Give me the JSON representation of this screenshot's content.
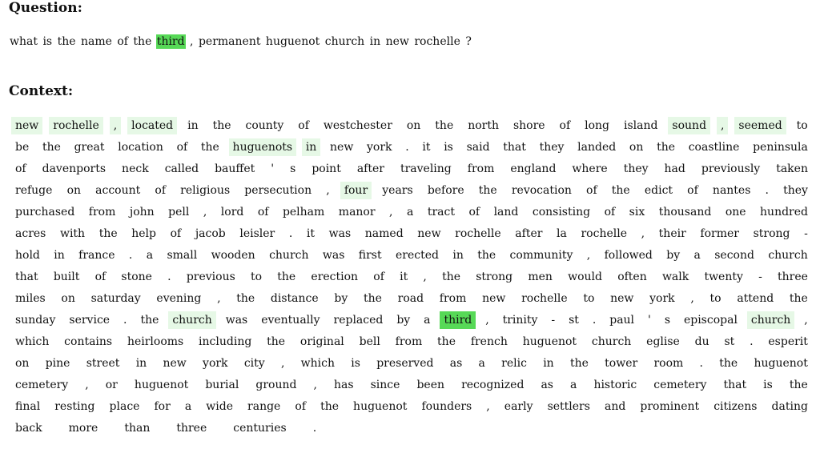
{
  "question_heading": "Question:",
  "context_heading": "Context:",
  "highlight_colors": {
    "strong": "#57d957",
    "light": "#e6f8e6"
  },
  "question_tokens": [
    {
      "t": "what",
      "h": ""
    },
    {
      "t": "is",
      "h": ""
    },
    {
      "t": "the",
      "h": ""
    },
    {
      "t": "name",
      "h": ""
    },
    {
      "t": "of",
      "h": ""
    },
    {
      "t": "the",
      "h": ""
    },
    {
      "t": "third",
      "h": "strong"
    },
    {
      "t": ",",
      "h": ""
    },
    {
      "t": "permanent",
      "h": ""
    },
    {
      "t": "huguenot",
      "h": ""
    },
    {
      "t": "church",
      "h": ""
    },
    {
      "t": "in",
      "h": ""
    },
    {
      "t": "new",
      "h": ""
    },
    {
      "t": "rochelle",
      "h": ""
    },
    {
      "t": "?",
      "h": ""
    }
  ],
  "context_lines": [
    [
      {
        "t": "new",
        "h": "light"
      },
      {
        "t": "rochelle",
        "h": "light"
      },
      {
        "t": ",",
        "h": "light"
      },
      {
        "t": "located",
        "h": "light"
      },
      {
        "t": "in",
        "h": ""
      },
      {
        "t": "the",
        "h": ""
      },
      {
        "t": "county",
        "h": ""
      },
      {
        "t": "of",
        "h": ""
      },
      {
        "t": "westchester",
        "h": ""
      },
      {
        "t": "on",
        "h": ""
      },
      {
        "t": "the",
        "h": ""
      },
      {
        "t": "north",
        "h": ""
      },
      {
        "t": "shore",
        "h": ""
      },
      {
        "t": "of",
        "h": ""
      },
      {
        "t": "long",
        "h": ""
      },
      {
        "t": "island",
        "h": ""
      },
      {
        "t": "sound",
        "h": "light"
      },
      {
        "t": ",",
        "h": "light"
      },
      {
        "t": "seemed",
        "h": "light"
      },
      {
        "t": "to",
        "h": ""
      }
    ],
    [
      {
        "t": "be",
        "h": ""
      },
      {
        "t": "the",
        "h": ""
      },
      {
        "t": "great",
        "h": ""
      },
      {
        "t": "location",
        "h": ""
      },
      {
        "t": "of",
        "h": ""
      },
      {
        "t": "the",
        "h": ""
      },
      {
        "t": "huguenots",
        "h": "light"
      },
      {
        "t": "in",
        "h": "light"
      },
      {
        "t": "new",
        "h": ""
      },
      {
        "t": "york",
        "h": ""
      },
      {
        "t": ".",
        "h": ""
      },
      {
        "t": "it",
        "h": ""
      },
      {
        "t": "is",
        "h": ""
      },
      {
        "t": "said",
        "h": ""
      },
      {
        "t": "that",
        "h": ""
      },
      {
        "t": "they",
        "h": ""
      },
      {
        "t": "landed",
        "h": ""
      },
      {
        "t": "on",
        "h": ""
      },
      {
        "t": "the",
        "h": ""
      },
      {
        "t": "coastline",
        "h": ""
      },
      {
        "t": "peninsula",
        "h": ""
      }
    ],
    [
      {
        "t": "of",
        "h": ""
      },
      {
        "t": "davenports",
        "h": ""
      },
      {
        "t": "neck",
        "h": ""
      },
      {
        "t": "called",
        "h": ""
      },
      {
        "t": "bauffet",
        "h": ""
      },
      {
        "t": "'",
        "h": ""
      },
      {
        "t": "s",
        "h": ""
      },
      {
        "t": "point",
        "h": ""
      },
      {
        "t": "after",
        "h": ""
      },
      {
        "t": "traveling",
        "h": ""
      },
      {
        "t": "from",
        "h": ""
      },
      {
        "t": "england",
        "h": ""
      },
      {
        "t": "where",
        "h": ""
      },
      {
        "t": "they",
        "h": ""
      },
      {
        "t": "had",
        "h": ""
      },
      {
        "t": "previously",
        "h": ""
      },
      {
        "t": "taken",
        "h": ""
      }
    ],
    [
      {
        "t": "refuge",
        "h": ""
      },
      {
        "t": "on",
        "h": ""
      },
      {
        "t": "account",
        "h": ""
      },
      {
        "t": "of",
        "h": ""
      },
      {
        "t": "religious",
        "h": ""
      },
      {
        "t": "persecution",
        "h": ""
      },
      {
        "t": ",",
        "h": ""
      },
      {
        "t": "four",
        "h": "light"
      },
      {
        "t": "years",
        "h": ""
      },
      {
        "t": "before",
        "h": ""
      },
      {
        "t": "the",
        "h": ""
      },
      {
        "t": "revocation",
        "h": ""
      },
      {
        "t": "of",
        "h": ""
      },
      {
        "t": "the",
        "h": ""
      },
      {
        "t": "edict",
        "h": ""
      },
      {
        "t": "of",
        "h": ""
      },
      {
        "t": "nantes",
        "h": ""
      },
      {
        "t": ".",
        "h": ""
      },
      {
        "t": "they",
        "h": ""
      }
    ],
    [
      {
        "t": "purchased",
        "h": ""
      },
      {
        "t": "from",
        "h": ""
      },
      {
        "t": "john",
        "h": ""
      },
      {
        "t": "pell",
        "h": ""
      },
      {
        "t": ",",
        "h": ""
      },
      {
        "t": "lord",
        "h": ""
      },
      {
        "t": "of",
        "h": ""
      },
      {
        "t": "pelham",
        "h": ""
      },
      {
        "t": "manor",
        "h": ""
      },
      {
        "t": ",",
        "h": ""
      },
      {
        "t": "a",
        "h": ""
      },
      {
        "t": "tract",
        "h": ""
      },
      {
        "t": "of",
        "h": ""
      },
      {
        "t": "land",
        "h": ""
      },
      {
        "t": "consisting",
        "h": ""
      },
      {
        "t": "of",
        "h": ""
      },
      {
        "t": "six",
        "h": ""
      },
      {
        "t": "thousand",
        "h": ""
      },
      {
        "t": "one",
        "h": ""
      },
      {
        "t": "hundred",
        "h": ""
      }
    ],
    [
      {
        "t": "acres",
        "h": ""
      },
      {
        "t": "with",
        "h": ""
      },
      {
        "t": "the",
        "h": ""
      },
      {
        "t": "help",
        "h": ""
      },
      {
        "t": "of",
        "h": ""
      },
      {
        "t": "jacob",
        "h": ""
      },
      {
        "t": "leisler",
        "h": ""
      },
      {
        "t": ".",
        "h": ""
      },
      {
        "t": "it",
        "h": ""
      },
      {
        "t": "was",
        "h": ""
      },
      {
        "t": "named",
        "h": ""
      },
      {
        "t": "new",
        "h": ""
      },
      {
        "t": "rochelle",
        "h": ""
      },
      {
        "t": "after",
        "h": ""
      },
      {
        "t": "la",
        "h": ""
      },
      {
        "t": "rochelle",
        "h": ""
      },
      {
        "t": ",",
        "h": ""
      },
      {
        "t": "their",
        "h": ""
      },
      {
        "t": "former",
        "h": ""
      },
      {
        "t": "strong",
        "h": ""
      },
      {
        "t": "-",
        "h": ""
      }
    ],
    [
      {
        "t": "hold",
        "h": ""
      },
      {
        "t": "in",
        "h": ""
      },
      {
        "t": "france",
        "h": ""
      },
      {
        "t": ".",
        "h": ""
      },
      {
        "t": "a",
        "h": ""
      },
      {
        "t": "small",
        "h": ""
      },
      {
        "t": "wooden",
        "h": ""
      },
      {
        "t": "church",
        "h": ""
      },
      {
        "t": "was",
        "h": ""
      },
      {
        "t": "first",
        "h": ""
      },
      {
        "t": "erected",
        "h": ""
      },
      {
        "t": "in",
        "h": ""
      },
      {
        "t": "the",
        "h": ""
      },
      {
        "t": "community",
        "h": ""
      },
      {
        "t": ",",
        "h": ""
      },
      {
        "t": "followed",
        "h": ""
      },
      {
        "t": "by",
        "h": ""
      },
      {
        "t": "a",
        "h": ""
      },
      {
        "t": "second",
        "h": ""
      },
      {
        "t": "church",
        "h": ""
      }
    ],
    [
      {
        "t": "that",
        "h": ""
      },
      {
        "t": "built",
        "h": ""
      },
      {
        "t": "of",
        "h": ""
      },
      {
        "t": "stone",
        "h": ""
      },
      {
        "t": ".",
        "h": ""
      },
      {
        "t": "previous",
        "h": ""
      },
      {
        "t": "to",
        "h": ""
      },
      {
        "t": "the",
        "h": ""
      },
      {
        "t": "erection",
        "h": ""
      },
      {
        "t": "of",
        "h": ""
      },
      {
        "t": "it",
        "h": ""
      },
      {
        "t": ",",
        "h": ""
      },
      {
        "t": "the",
        "h": ""
      },
      {
        "t": "strong",
        "h": ""
      },
      {
        "t": "men",
        "h": ""
      },
      {
        "t": "would",
        "h": ""
      },
      {
        "t": "often",
        "h": ""
      },
      {
        "t": "walk",
        "h": ""
      },
      {
        "t": "twenty",
        "h": ""
      },
      {
        "t": "-",
        "h": ""
      },
      {
        "t": "three",
        "h": ""
      }
    ],
    [
      {
        "t": "miles",
        "h": ""
      },
      {
        "t": "on",
        "h": ""
      },
      {
        "t": "saturday",
        "h": ""
      },
      {
        "t": "evening",
        "h": ""
      },
      {
        "t": ",",
        "h": ""
      },
      {
        "t": "the",
        "h": ""
      },
      {
        "t": "distance",
        "h": ""
      },
      {
        "t": "by",
        "h": ""
      },
      {
        "t": "the",
        "h": ""
      },
      {
        "t": "road",
        "h": ""
      },
      {
        "t": "from",
        "h": ""
      },
      {
        "t": "new",
        "h": ""
      },
      {
        "t": "rochelle",
        "h": ""
      },
      {
        "t": "to",
        "h": ""
      },
      {
        "t": "new",
        "h": ""
      },
      {
        "t": "york",
        "h": ""
      },
      {
        "t": ",",
        "h": ""
      },
      {
        "t": "to",
        "h": ""
      },
      {
        "t": "attend",
        "h": ""
      },
      {
        "t": "the",
        "h": ""
      }
    ],
    [
      {
        "t": "sunday",
        "h": ""
      },
      {
        "t": "service",
        "h": ""
      },
      {
        "t": ".",
        "h": ""
      },
      {
        "t": "the",
        "h": ""
      },
      {
        "t": "church",
        "h": "light"
      },
      {
        "t": "was",
        "h": ""
      },
      {
        "t": "eventually",
        "h": ""
      },
      {
        "t": "replaced",
        "h": ""
      },
      {
        "t": "by",
        "h": ""
      },
      {
        "t": "a",
        "h": ""
      },
      {
        "t": "third",
        "h": "strong"
      },
      {
        "t": ",",
        "h": ""
      },
      {
        "t": "trinity",
        "h": ""
      },
      {
        "t": "-",
        "h": ""
      },
      {
        "t": "st",
        "h": ""
      },
      {
        "t": ".",
        "h": ""
      },
      {
        "t": "paul",
        "h": ""
      },
      {
        "t": "'",
        "h": ""
      },
      {
        "t": "s",
        "h": ""
      },
      {
        "t": "episcopal",
        "h": ""
      },
      {
        "t": "church",
        "h": "light"
      },
      {
        "t": ",",
        "h": ""
      }
    ],
    [
      {
        "t": "which",
        "h": ""
      },
      {
        "t": "contains",
        "h": ""
      },
      {
        "t": "heirlooms",
        "h": ""
      },
      {
        "t": "including",
        "h": ""
      },
      {
        "t": "the",
        "h": ""
      },
      {
        "t": "original",
        "h": ""
      },
      {
        "t": "bell",
        "h": ""
      },
      {
        "t": "from",
        "h": ""
      },
      {
        "t": "the",
        "h": ""
      },
      {
        "t": "french",
        "h": ""
      },
      {
        "t": "huguenot",
        "h": ""
      },
      {
        "t": "church",
        "h": ""
      },
      {
        "t": "eglise",
        "h": ""
      },
      {
        "t": "du",
        "h": ""
      },
      {
        "t": "st",
        "h": ""
      },
      {
        "t": ".",
        "h": ""
      },
      {
        "t": "esperit",
        "h": ""
      }
    ],
    [
      {
        "t": "on",
        "h": ""
      },
      {
        "t": "pine",
        "h": ""
      },
      {
        "t": "street",
        "h": ""
      },
      {
        "t": "in",
        "h": ""
      },
      {
        "t": "new",
        "h": ""
      },
      {
        "t": "york",
        "h": ""
      },
      {
        "t": "city",
        "h": ""
      },
      {
        "t": ",",
        "h": ""
      },
      {
        "t": "which",
        "h": ""
      },
      {
        "t": "is",
        "h": ""
      },
      {
        "t": "preserved",
        "h": ""
      },
      {
        "t": "as",
        "h": ""
      },
      {
        "t": "a",
        "h": ""
      },
      {
        "t": "relic",
        "h": ""
      },
      {
        "t": "in",
        "h": ""
      },
      {
        "t": "the",
        "h": ""
      },
      {
        "t": "tower",
        "h": ""
      },
      {
        "t": "room",
        "h": ""
      },
      {
        "t": ".",
        "h": ""
      },
      {
        "t": "the",
        "h": ""
      },
      {
        "t": "huguenot",
        "h": ""
      }
    ],
    [
      {
        "t": "cemetery",
        "h": ""
      },
      {
        "t": ",",
        "h": ""
      },
      {
        "t": "or",
        "h": ""
      },
      {
        "t": "huguenot",
        "h": ""
      },
      {
        "t": "burial",
        "h": ""
      },
      {
        "t": "ground",
        "h": ""
      },
      {
        "t": ",",
        "h": ""
      },
      {
        "t": "has",
        "h": ""
      },
      {
        "t": "since",
        "h": ""
      },
      {
        "t": "been",
        "h": ""
      },
      {
        "t": "recognized",
        "h": ""
      },
      {
        "t": "as",
        "h": ""
      },
      {
        "t": "a",
        "h": ""
      },
      {
        "t": "historic",
        "h": ""
      },
      {
        "t": "cemetery",
        "h": ""
      },
      {
        "t": "that",
        "h": ""
      },
      {
        "t": "is",
        "h": ""
      },
      {
        "t": "the",
        "h": ""
      }
    ],
    [
      {
        "t": "final",
        "h": ""
      },
      {
        "t": "resting",
        "h": ""
      },
      {
        "t": "place",
        "h": ""
      },
      {
        "t": "for",
        "h": ""
      },
      {
        "t": "a",
        "h": ""
      },
      {
        "t": "wide",
        "h": ""
      },
      {
        "t": "range",
        "h": ""
      },
      {
        "t": "of",
        "h": ""
      },
      {
        "t": "the",
        "h": ""
      },
      {
        "t": "huguenot",
        "h": ""
      },
      {
        "t": "founders",
        "h": ""
      },
      {
        "t": ",",
        "h": ""
      },
      {
        "t": "early",
        "h": ""
      },
      {
        "t": "settlers",
        "h": ""
      },
      {
        "t": "and",
        "h": ""
      },
      {
        "t": "prominent",
        "h": ""
      },
      {
        "t": "citizens",
        "h": ""
      },
      {
        "t": "dating",
        "h": ""
      }
    ],
    [
      {
        "t": "back",
        "h": ""
      },
      {
        "t": "more",
        "h": ""
      },
      {
        "t": "than",
        "h": ""
      },
      {
        "t": "three",
        "h": ""
      },
      {
        "t": "centuries",
        "h": ""
      },
      {
        "t": ".",
        "h": ""
      }
    ]
  ]
}
